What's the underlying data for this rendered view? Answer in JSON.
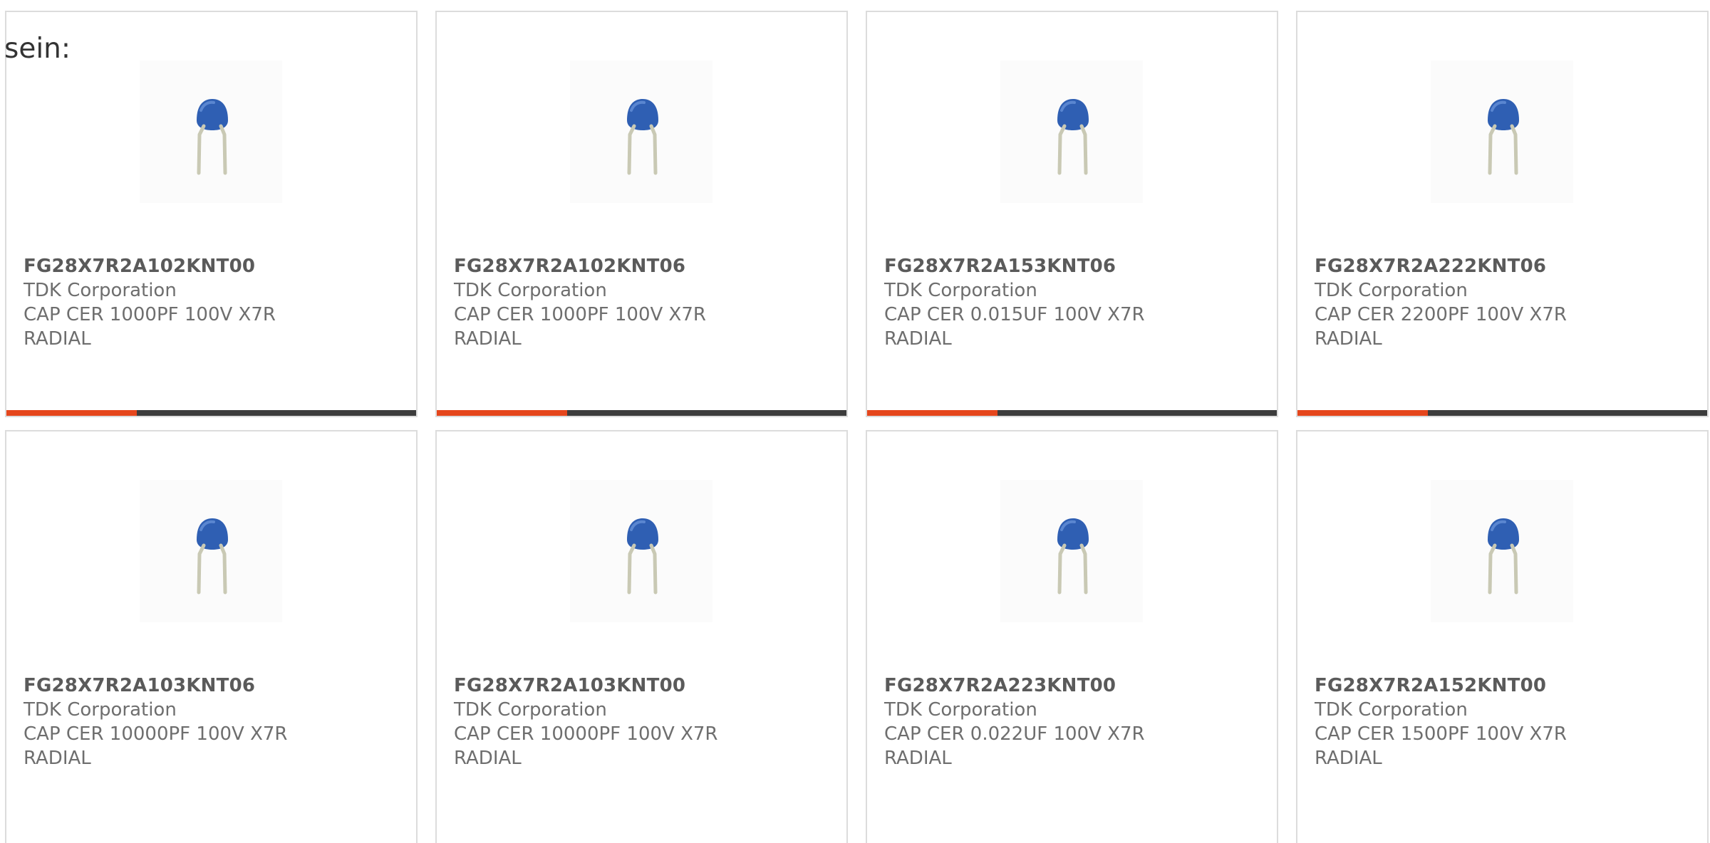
{
  "heading": "sein:",
  "colors": {
    "accent": "#e5461c",
    "bar": "#3c3c3c",
    "border": "#dcdcdc",
    "text": "#6e6e6e",
    "capacitor_body": "#2f5fb3",
    "capacitor_leads": "#c9c9b4"
  },
  "products": [
    {
      "part_number": "FG28X7R2A102KNT00",
      "manufacturer": "TDK Corporation",
      "description": "CAP CER 1000PF 100V X7R RADIAL",
      "image": "ceramic-capacitor-radial-icon"
    },
    {
      "part_number": "FG28X7R2A102KNT06",
      "manufacturer": "TDK Corporation",
      "description": "CAP CER 1000PF 100V X7R RADIAL",
      "image": "ceramic-capacitor-radial-icon"
    },
    {
      "part_number": "FG28X7R2A153KNT06",
      "manufacturer": "TDK Corporation",
      "description": "CAP CER 0.015UF 100V X7R RADIAL",
      "image": "ceramic-capacitor-radial-icon"
    },
    {
      "part_number": "FG28X7R2A222KNT06",
      "manufacturer": "TDK Corporation",
      "description": "CAP CER 2200PF 100V X7R RADIAL",
      "image": "ceramic-capacitor-radial-icon"
    },
    {
      "part_number": "FG28X7R2A103KNT06",
      "manufacturer": "TDK Corporation",
      "description": "CAP CER 10000PF 100V X7R RADIAL",
      "image": "ceramic-capacitor-radial-icon"
    },
    {
      "part_number": "FG28X7R2A103KNT00",
      "manufacturer": "TDK Corporation",
      "description": "CAP CER 10000PF 100V X7R RADIAL",
      "image": "ceramic-capacitor-radial-icon"
    },
    {
      "part_number": "FG28X7R2A223KNT00",
      "manufacturer": "TDK Corporation",
      "description": "CAP CER 0.022UF 100V X7R RADIAL",
      "image": "ceramic-capacitor-radial-icon"
    },
    {
      "part_number": "FG28X7R2A152KNT00",
      "manufacturer": "TDK Corporation",
      "description": "CAP CER 1500PF 100V X7R RADIAL",
      "image": "ceramic-capacitor-radial-icon"
    }
  ]
}
